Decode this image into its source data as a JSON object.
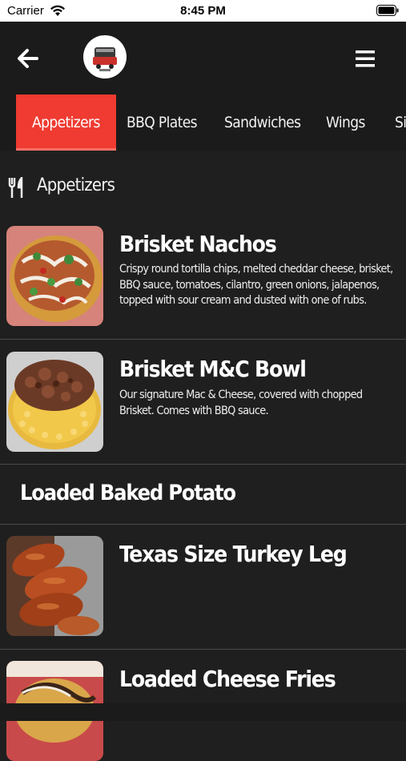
{
  "status_bar": {
    "carrier": "Carrier",
    "time": "8:45 PM"
  },
  "header": {
    "back_icon": "arrow-left-icon",
    "menu_icon": "hamburger-menu-icon",
    "logo_icon": "restaurant-logo"
  },
  "tabs": [
    {
      "label": "Appetizers",
      "active": true
    },
    {
      "label": "BBQ Plates",
      "active": false
    },
    {
      "label": "Sandwiches",
      "active": false
    },
    {
      "label": "Wings",
      "active": false
    },
    {
      "label": "Si",
      "active": false
    }
  ],
  "section": {
    "title": "Appetizers",
    "icon": "fork-knife-icon"
  },
  "items": [
    {
      "name": "Brisket Nachos",
      "description": "Crispy round tortilla chips, melted cheddar cheese, brisket, BBQ sauce, tomatoes, cilantro, green onions, jalapenos, topped with sour cream and dusted with one of rubs."
    },
    {
      "name": "Brisket M&C Bowl",
      "description": "Our signature Mac & Cheese, covered with chopped Brisket. Comes with BBQ sauce."
    },
    {
      "category": "Loaded Baked Potato"
    },
    {
      "name": "Texas Size Turkey Leg",
      "description": ""
    },
    {
      "name": "Loaded Cheese Fries",
      "description": ""
    }
  ],
  "colors": {
    "accent": "#ef3b31",
    "background": "#1f1f1f",
    "header": "#1b1b1b"
  }
}
